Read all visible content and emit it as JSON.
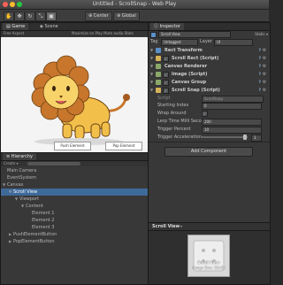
{
  "window": {
    "title": "Untitled - ScrollSnap - Web Play"
  },
  "toolbar": {
    "tools": [
      "hand",
      "move",
      "rotate",
      "scale",
      "rect"
    ],
    "pivot": "Center",
    "space": "Global"
  },
  "game": {
    "tabs": [
      "Game",
      "Scene"
    ],
    "aspect": "Free Aspect",
    "options": "Maximize on Play  Mute audio  Stats",
    "buttons": {
      "push": "Push Element",
      "pop": "Pop Element"
    }
  },
  "hierarchy": {
    "tab": "Hierarchy",
    "create": "Create ▾",
    "items": [
      {
        "label": "Main Camera",
        "depth": 0,
        "arrow": ""
      },
      {
        "label": "EventSystem",
        "depth": 0,
        "arrow": ""
      },
      {
        "label": "Canvas",
        "depth": 0,
        "arrow": "▼"
      },
      {
        "label": "Scroll View",
        "depth": 1,
        "arrow": "▼",
        "selected": true
      },
      {
        "label": "Viewport",
        "depth": 2,
        "arrow": "▼"
      },
      {
        "label": "Content",
        "depth": 3,
        "arrow": "▼"
      },
      {
        "label": "Element 1",
        "depth": 4,
        "arrow": ""
      },
      {
        "label": "Element 2",
        "depth": 4,
        "arrow": ""
      },
      {
        "label": "Element 3",
        "depth": 4,
        "arrow": ""
      },
      {
        "label": "PushElementButton",
        "depth": 1,
        "arrow": "▶"
      },
      {
        "label": "PopElementButton",
        "depth": 1,
        "arrow": "▶"
      }
    ]
  },
  "inspector": {
    "tab": "Inspector",
    "object_name": "Scroll View",
    "static_label": "Static ▾",
    "tag_label": "Tag",
    "tag_value": "Untagged",
    "layer_label": "Layer",
    "layer_value": "UI",
    "components": [
      {
        "name": "Rect Transform",
        "checkbox": false,
        "color": "#5a8fc9"
      },
      {
        "name": "Scroll Rect (Script)",
        "checkbox": true,
        "color": "#d4b25a"
      },
      {
        "name": "Canvas Renderer",
        "checkbox": false,
        "color": "#8aa86a"
      },
      {
        "name": "Image (Script)",
        "checkbox": true,
        "color": "#8aa86a"
      },
      {
        "name": "Canvas Group",
        "checkbox": true,
        "color": "#8aa86a"
      },
      {
        "name": "Scroll Snap (Script)",
        "checkbox": true,
        "color": "#d4b25a"
      }
    ],
    "script_label": "Script",
    "script_value": "ScrollSnap",
    "props": [
      {
        "label": "Starting Index",
        "value": "0",
        "type": "text"
      },
      {
        "label": "Wrap Around",
        "value": "✓",
        "type": "check"
      },
      {
        "label": "Lerp Time Milli Seconds",
        "value": "200",
        "type": "text"
      },
      {
        "label": "Trigger Percent",
        "value": "10",
        "type": "text"
      },
      {
        "label": "Trigger Acceleration",
        "value": "1",
        "type": "slider",
        "fraction": 0.98
      }
    ],
    "add_component": "Add Component"
  },
  "preview": {
    "title": "Scroll View",
    "caption": "Scroll View",
    "subcaption": "Image Size: 32x32"
  },
  "colors": {
    "accent": "#3e6a9a",
    "panel": "#383838",
    "lion_body": "#f2c04a",
    "lion_mane": "#c7762c"
  }
}
